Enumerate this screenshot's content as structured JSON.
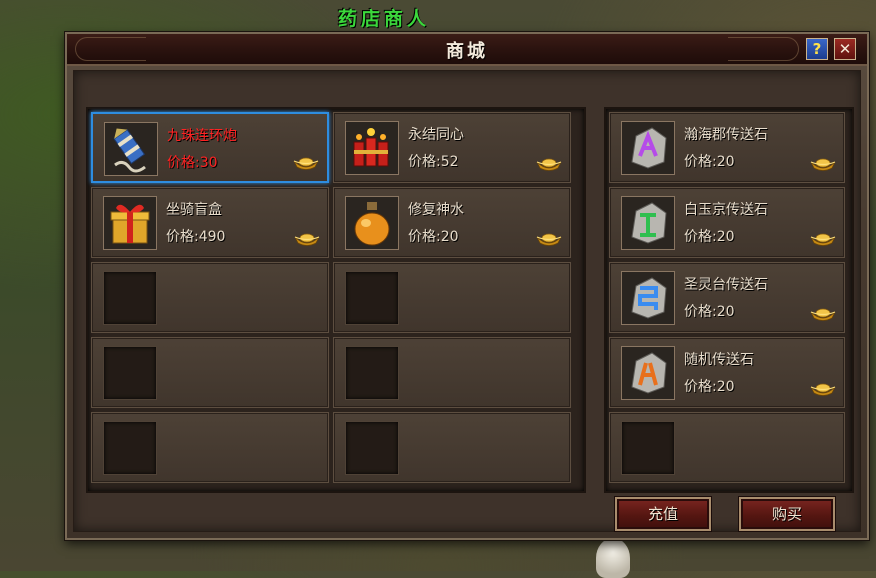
{
  "npc_name": "药店商人",
  "window": {
    "title": "商城",
    "help_label": "?",
    "close_label": "✕"
  },
  "left_items": [
    {
      "name": "九珠连环炮",
      "price": "价格:30",
      "icon": "firework-rocket-icon",
      "selected": true,
      "highlight_color": "#ff2222"
    },
    {
      "name": "永结同心",
      "price": "价格:52",
      "icon": "firecracker-icon"
    },
    {
      "name": "坐骑盲盒",
      "price": "价格:490",
      "icon": "gift-box-icon"
    },
    {
      "name": "修复神水",
      "price": "价格:20",
      "icon": "potion-flask-icon"
    },
    {
      "empty": true
    },
    {
      "empty": true
    },
    {
      "empty": true
    },
    {
      "empty": true
    },
    {
      "empty": true
    },
    {
      "empty": true
    }
  ],
  "right_items": [
    {
      "name": "瀚海郡传送石",
      "price": "价格:20",
      "icon": "teleport-stone-purple-icon"
    },
    {
      "name": "白玉京传送石",
      "price": "价格:20",
      "icon": "teleport-stone-green-icon"
    },
    {
      "name": "圣灵台传送石",
      "price": "价格:20",
      "icon": "teleport-stone-blue-icon"
    },
    {
      "name": "随机传送石",
      "price": "价格:20",
      "icon": "teleport-stone-orange-icon"
    },
    {
      "empty": true
    }
  ],
  "currency_icon": "gold-ingot-icon",
  "buttons": {
    "recharge": "充值",
    "buy": "购买"
  },
  "colors": {
    "selected_border": "#2e8de0",
    "title_bar": "#2b130f",
    "button_red": "#551611"
  }
}
